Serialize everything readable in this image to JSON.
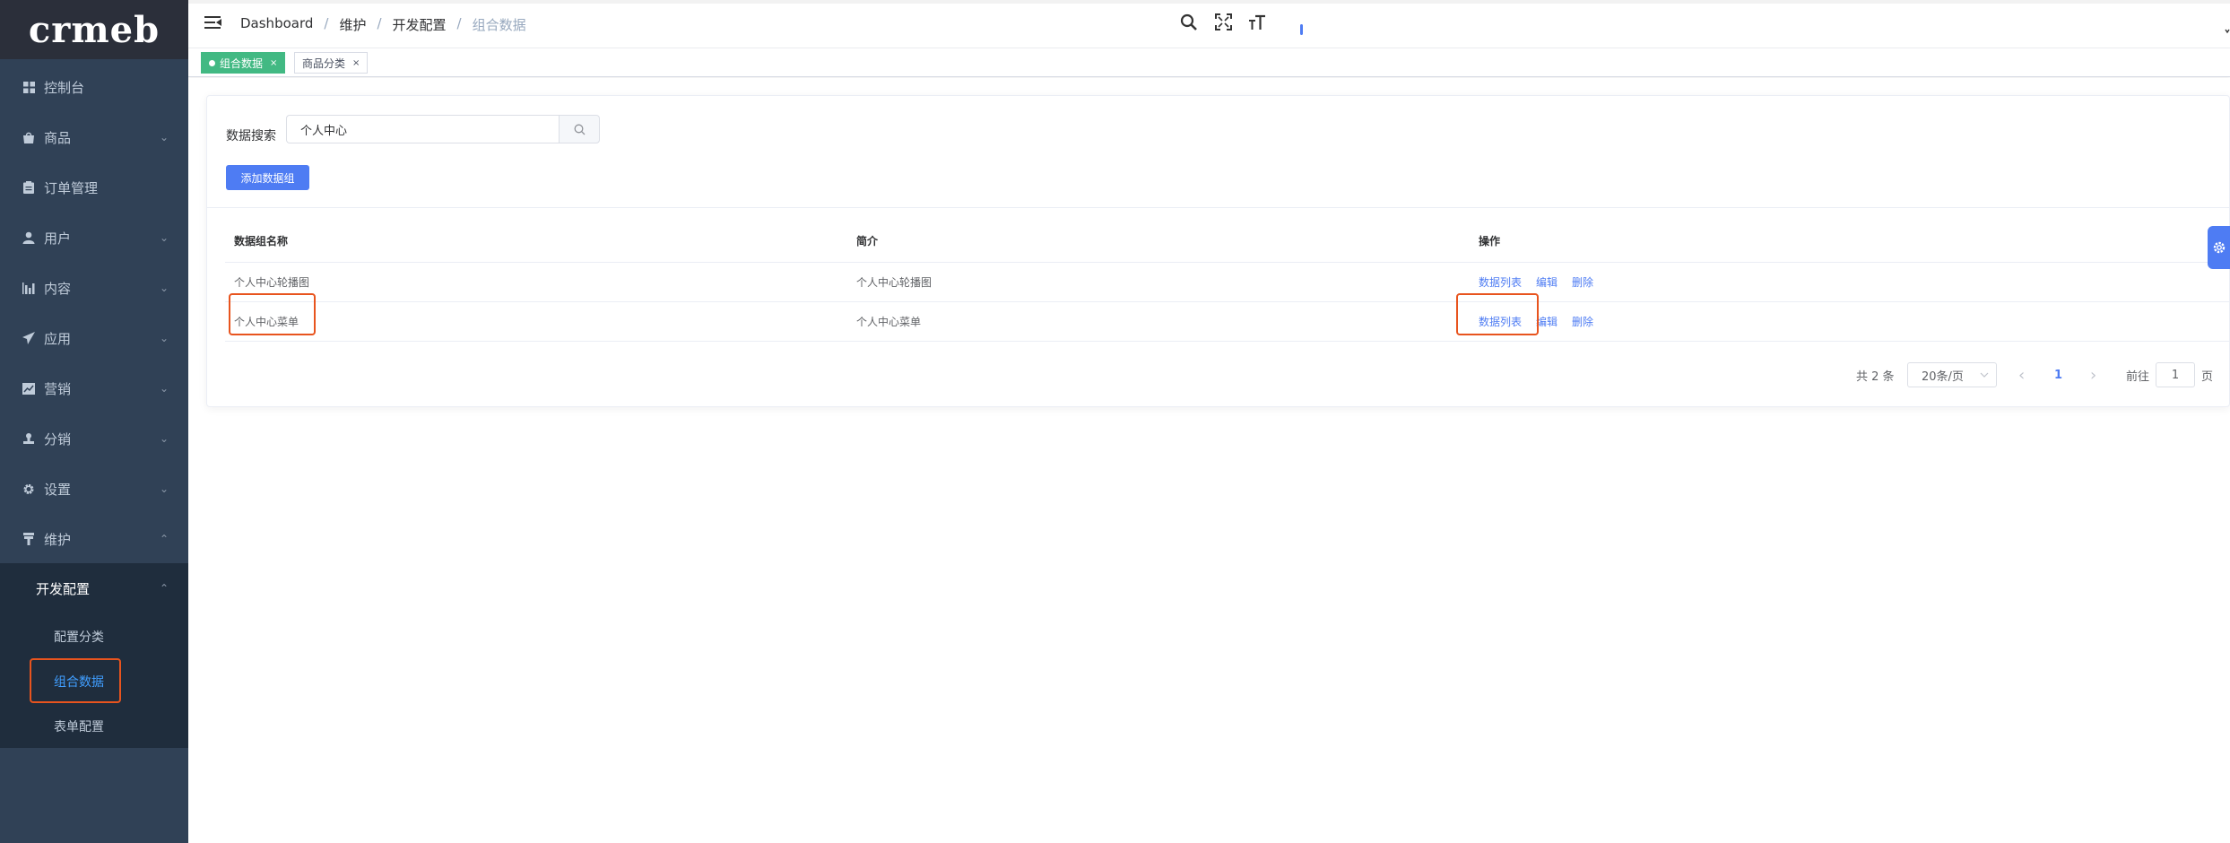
{
  "app": {
    "logo_text": "crmeb"
  },
  "sidebar": {
    "items": [
      {
        "label": "控制台",
        "icon": "dashboard-icon",
        "has_arrow": false
      },
      {
        "label": "商品",
        "icon": "shopping-bag-icon",
        "has_arrow": true
      },
      {
        "label": "订单管理",
        "icon": "clipboard-icon",
        "has_arrow": false
      },
      {
        "label": "用户",
        "icon": "user-icon",
        "has_arrow": true
      },
      {
        "label": "内容",
        "icon": "bar-chart-icon",
        "has_arrow": true
      },
      {
        "label": "应用",
        "icon": "send-icon",
        "has_arrow": true
      },
      {
        "label": "营销",
        "icon": "trend-chart-icon",
        "has_arrow": true
      },
      {
        "label": "分销",
        "icon": "person-stamp-icon",
        "has_arrow": true
      },
      {
        "label": "设置",
        "icon": "gear-icon",
        "has_arrow": true
      },
      {
        "label": "维护",
        "icon": "tool-icon",
        "has_arrow": true,
        "expanded": true
      }
    ],
    "submenu": {
      "label": "开发配置",
      "items": [
        {
          "label": "配置分类",
          "active": false
        },
        {
          "label": "组合数据",
          "active": true
        },
        {
          "label": "表单配置",
          "active": false
        }
      ]
    },
    "arrow_down": "⌄",
    "arrow_up": "⌃"
  },
  "header": {
    "breadcrumb": [
      "Dashboard",
      "维护",
      "开发配置",
      "组合数据"
    ],
    "separator": "/"
  },
  "tags": [
    {
      "label": "组合数据",
      "active": true,
      "close": "×"
    },
    {
      "label": "商品分类",
      "active": false,
      "close": "×"
    }
  ],
  "search": {
    "label": "数据搜索",
    "value": "个人中心"
  },
  "add_button_label": "添加数据组",
  "table": {
    "headers": [
      "数据组名称",
      "简介",
      "操作"
    ],
    "rows": [
      {
        "name": "个人中心轮播图",
        "desc": "个人中心轮播图",
        "actions": [
          "数据列表",
          "编辑",
          "删除"
        ]
      },
      {
        "name": "个人中心菜单",
        "desc": "个人中心菜单",
        "actions": [
          "数据列表",
          "编辑",
          "删除"
        ]
      }
    ]
  },
  "pagination": {
    "total_text": "共 2 条",
    "page_size": "20条/页",
    "prev": "‹",
    "current_page": "1",
    "next": "›",
    "goto_label": "前往",
    "goto_value": "1",
    "page_unit": "页"
  },
  "colors": {
    "sidebar_bg": "#304156",
    "accent": "#4e7cf3",
    "active_tag": "#42b983",
    "highlight": "#e8541e"
  }
}
